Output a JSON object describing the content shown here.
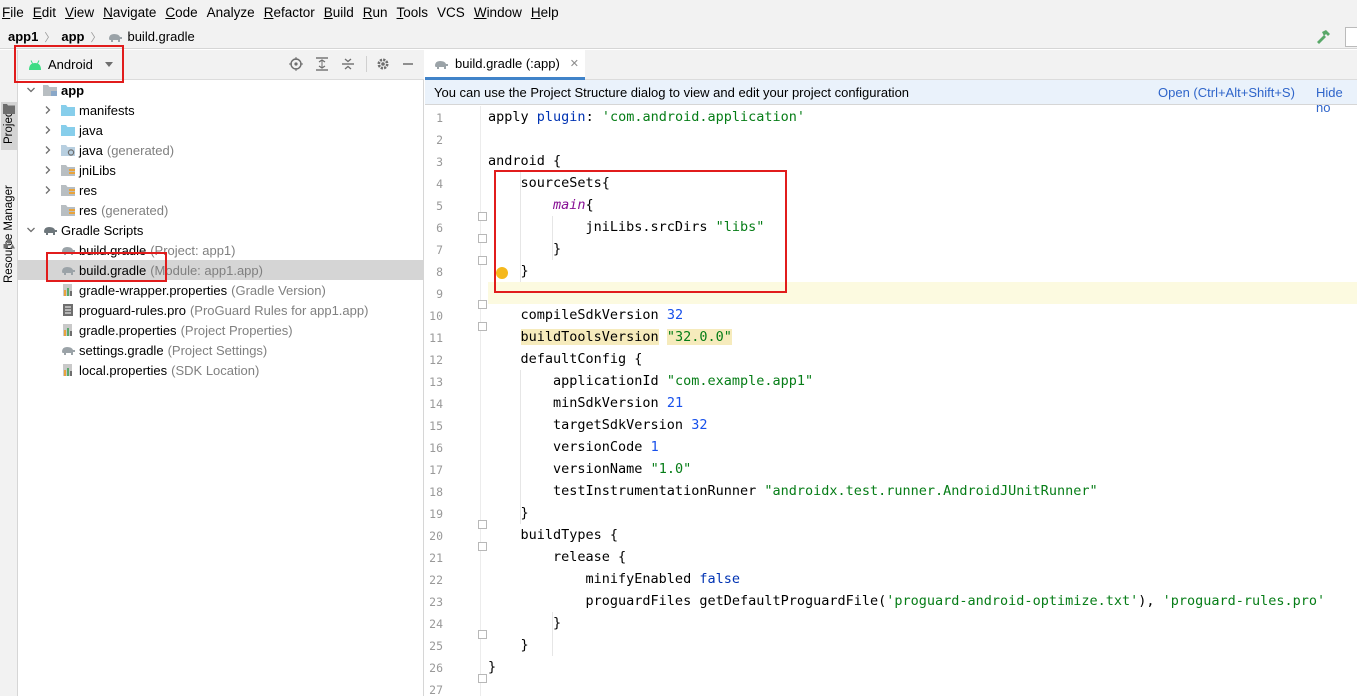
{
  "menu": [
    {
      "label": "File",
      "u": "F",
      "rest": "ile"
    },
    {
      "label": "Edit",
      "u": "E",
      "rest": "dit"
    },
    {
      "label": "View",
      "u": "V",
      "rest": "iew"
    },
    {
      "label": "Navigate",
      "u": "N",
      "rest": "avigate"
    },
    {
      "label": "Code",
      "u": "C",
      "rest": "ode"
    },
    {
      "label": "Analyze",
      "u": "",
      "rest": "Analyze"
    },
    {
      "label": "Refactor",
      "u": "R",
      "rest": "efactor"
    },
    {
      "label": "Build",
      "u": "B",
      "rest": "uild"
    },
    {
      "label": "Run",
      "u": "R",
      "rest": "un"
    },
    {
      "label": "Tools",
      "u": "T",
      "rest": "ools"
    },
    {
      "label": "VCS",
      "u": "",
      "rest": "VCS"
    },
    {
      "label": "Window",
      "u": "W",
      "rest": "indow"
    },
    {
      "label": "Help",
      "u": "H",
      "rest": "elp"
    }
  ],
  "breadcrumb": {
    "project": "app1",
    "module": "app",
    "file": "build.gradle"
  },
  "sidebar": {
    "project_tab": "Project",
    "resource_tab": "Resource Manager"
  },
  "project_panel": {
    "view_mode": "Android",
    "tree": {
      "app": "app",
      "manifests": "manifests",
      "java": "java",
      "java_gen": "java",
      "java_gen_hint": "(generated)",
      "jnilibs": "jniLibs",
      "res": "res",
      "res_gen": "res",
      "res_gen_hint": "(generated)",
      "gradle_scripts": "Gradle Scripts",
      "f1": "build.gradle",
      "f1_hint": "(Project: app1)",
      "f2": "build.gradle",
      "f2_hint": "(Module: app1.app)",
      "f3": "gradle-wrapper.properties",
      "f3_hint": "(Gradle Version)",
      "f4": "proguard-rules.pro",
      "f4_hint": "(ProGuard Rules for app1.app)",
      "f5": "gradle.properties",
      "f5_hint": "(Project Properties)",
      "f6": "settings.gradle",
      "f6_hint": "(Project Settings)",
      "f7": "local.properties",
      "f7_hint": "(SDK Location)"
    }
  },
  "editor": {
    "tab_label": "build.gradle (:app)",
    "banner_text": "You can use the Project Structure dialog to view and edit your project configuration",
    "banner_open": "Open (Ctrl+Alt+Shift+S)",
    "banner_hide": "Hide no",
    "line_numbers": [
      "1",
      "2",
      "3",
      "4",
      "5",
      "6",
      "7",
      "8",
      "9",
      "10",
      "11",
      "12",
      "13",
      "14",
      "15",
      "16",
      "17",
      "18",
      "19",
      "20",
      "21",
      "22",
      "23",
      "24",
      "25",
      "26",
      "27"
    ],
    "code": {
      "l1a": "apply ",
      "l1b": "plugin",
      "l1c": ": ",
      "l1d": "'com.android.application'",
      "l3": "android {",
      "l4": "    sourceSets{",
      "l5a": "        ",
      "l5b": "main",
      "l5c": "{",
      "l6a": "            jniLibs.srcDirs ",
      "l6b": "\"libs\"",
      "l7": "        }",
      "l8": "    }",
      "l10a": "    compileSdkVersion ",
      "l10b": "32",
      "l11a": "buildToolsVersion",
      "l11b": "\"32.0.0\"",
      "l12": "    defaultConfig {",
      "l13a": "        applicationId ",
      "l13b": "\"com.example.app1\"",
      "l14a": "        minSdkVersion ",
      "l14b": "21",
      "l15a": "        targetSdkVersion ",
      "l15b": "32",
      "l16a": "        versionCode ",
      "l16b": "1",
      "l17a": "        versionName ",
      "l17b": "\"1.0\"",
      "l18a": "        testInstrumentationRunner ",
      "l18b": "\"androidx.test.runner.AndroidJUnitRunner\"",
      "l19": "    }",
      "l20": "    buildTypes {",
      "l21": "        release {",
      "l22a": "            minifyEnabled ",
      "l22b": "false",
      "l23a": "            proguardFiles getDefaultProguardFile(",
      "l23b": "'proguard-android-optimize.txt'",
      "l23c": "), ",
      "l23d": "'proguard-rules.pro'",
      "l24": "        }",
      "l25": "    }",
      "l26": "}"
    }
  },
  "colors": {
    "annotation_red": "#e11c1c",
    "link_blue": "#2f65ca",
    "string_green": "#067d17",
    "number_blue": "#1750eb",
    "android_green": "#3ddc84"
  }
}
